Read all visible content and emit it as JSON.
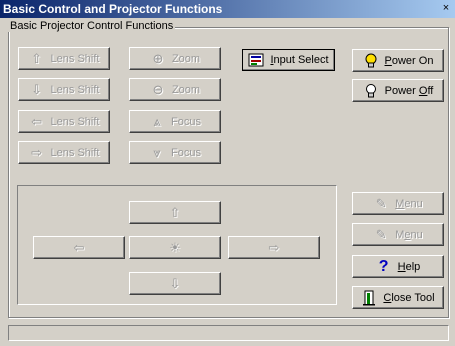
{
  "window": {
    "title": "Basic Control and Projector Functions",
    "close_glyph": "×"
  },
  "group": {
    "legend": "Basic Projector Control Functions"
  },
  "lens": {
    "shift_up": "Lens Shift",
    "shift_down": "Lens Shift",
    "shift_left": "Lens Shift",
    "shift_right": "Lens Shift"
  },
  "zoomfocus": {
    "zoom_in": "Zoom",
    "zoom_out": "Zoom",
    "focus_far": "Focus",
    "focus_near": "Focus"
  },
  "input_select": {
    "pre": "",
    "key": "I",
    "post": "nput Select"
  },
  "power_on": {
    "pre": "",
    "key": "P",
    "post": "ower On"
  },
  "power_off": {
    "pre": "Power ",
    "key": "O",
    "post": "ff"
  },
  "menu": {
    "menu1_pre": "",
    "menu1_key": "M",
    "menu1_post": "enu",
    "menu2_pre": "M",
    "menu2_key": "e",
    "menu2_post": "nu"
  },
  "help": {
    "pre": "",
    "key": "H",
    "post": "elp"
  },
  "close_tool": {
    "pre": "",
    "key": "C",
    "post": "lose Tool"
  },
  "icons": {
    "arrow_up": "⇧",
    "arrow_down": "⇩",
    "arrow_left": "⇦",
    "arrow_right": "⇨",
    "center": "☀",
    "zoom_in": "⊕",
    "zoom_out": "⊖",
    "focus_far": "⩓",
    "focus_near": "⩔",
    "bulb": "💡",
    "menu_pencil": "✎",
    "help": "?",
    "close_tool": "▐"
  },
  "status_bar": {
    "text": ""
  }
}
